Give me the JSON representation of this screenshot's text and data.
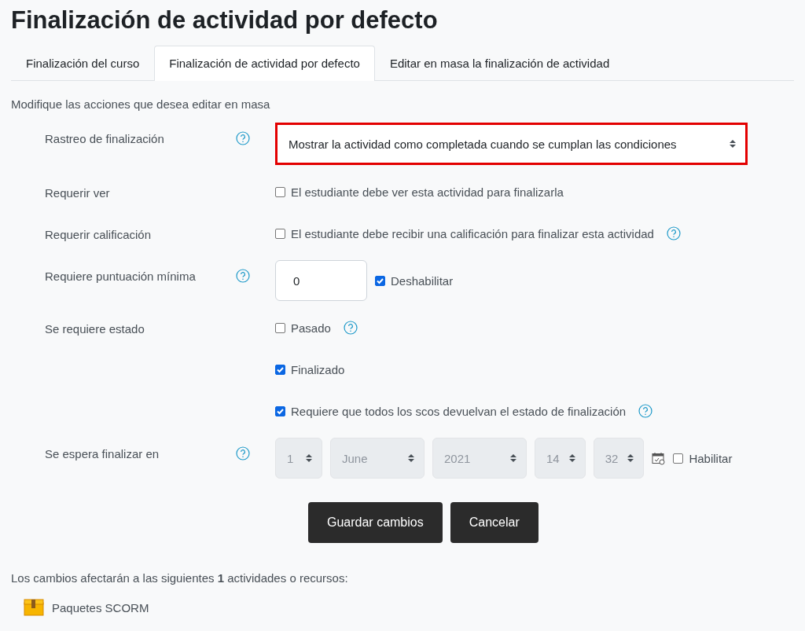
{
  "page_title": "Finalización de actividad por defecto",
  "tabs": [
    {
      "label": "Finalización del curso",
      "selected": false
    },
    {
      "label": "Finalización de actividad por defecto",
      "selected": true
    },
    {
      "label": "Editar en masa la finalización de actividad",
      "selected": false
    }
  ],
  "intro": "Modifique las acciones que desea editar en masa",
  "rows": [
    {
      "label": "Rastreo de finalización",
      "help": true,
      "lines": [
        [
          {
            "kind": "select",
            "value": "Mostrar la actividad como completada cuando se cumplan las condiciones",
            "highlighted": true,
            "disabled": false
          }
        ]
      ]
    },
    {
      "label": "Requerir ver",
      "help": false,
      "lines": [
        [
          {
            "kind": "checkbox",
            "label": "El estudiante debe ver esta actividad para finalizarla",
            "checked": false,
            "help": false
          }
        ]
      ]
    },
    {
      "label": "Requerir calificación",
      "help": false,
      "lines": [
        [
          {
            "kind": "checkbox",
            "label": "El estudiante debe recibir una calificación para finalizar esta actividad",
            "checked": false,
            "help": true
          }
        ]
      ]
    },
    {
      "label": "Requiere puntuación mínima",
      "help": true,
      "lines": [
        [
          {
            "kind": "number",
            "value": "0"
          },
          {
            "kind": "checkbox",
            "label": "Deshabilitar",
            "checked": true,
            "help": false
          }
        ]
      ]
    },
    {
      "label": "Se requiere estado",
      "help": false,
      "lines": [
        [
          {
            "kind": "checkbox",
            "label": "Pasado",
            "checked": false,
            "help": true
          }
        ],
        [
          {
            "kind": "checkbox",
            "label": "Finalizado",
            "checked": true,
            "help": false
          }
        ],
        [
          {
            "kind": "checkbox",
            "label": "Requiere que todos los scos devuelvan el estado de finalización",
            "checked": true,
            "help": true
          }
        ]
      ]
    },
    {
      "label": "Se espera finalizar en",
      "help": true,
      "lines": [
        [
          {
            "kind": "select",
            "value": "1",
            "highlighted": false,
            "disabled": true
          },
          {
            "kind": "select",
            "value": "June",
            "highlighted": false,
            "disabled": true
          },
          {
            "kind": "select",
            "value": "2021",
            "highlighted": false,
            "disabled": true
          },
          {
            "kind": "select",
            "value": "14",
            "highlighted": false,
            "disabled": true
          },
          {
            "kind": "select",
            "value": "32",
            "highlighted": false,
            "disabled": true
          },
          {
            "kind": "calendar"
          },
          {
            "kind": "checkbox",
            "label": "Habilitar",
            "checked": false,
            "help": false
          }
        ]
      ]
    }
  ],
  "buttons": [
    {
      "label": "Guardar cambios"
    },
    {
      "label": "Cancelar"
    }
  ],
  "summary": "Los cambios afectarán a las siguientes **1** actividades o recursos:",
  "modules": [
    {
      "name": "Paquetes SCORM"
    }
  ]
}
